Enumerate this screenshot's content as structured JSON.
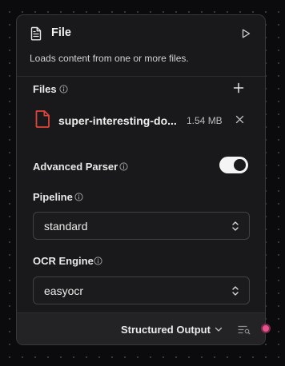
{
  "node": {
    "title": "File",
    "icon": "file-text-icon",
    "description": "Loads content from one or more files."
  },
  "files": {
    "label": "Files",
    "items": [
      {
        "name": "super-interesting-do...",
        "size": "1.54 MB",
        "icon": "pdf-file-icon"
      }
    ]
  },
  "advanced_parser": {
    "label": "Advanced Parser",
    "enabled": true
  },
  "pipeline": {
    "label": "Pipeline",
    "value": "standard"
  },
  "ocr_engine": {
    "label": "OCR Engine",
    "value": "easyocr"
  },
  "output": {
    "label": "Structured Output"
  },
  "colors": {
    "accent_handle": "#e8528e",
    "pdf_icon": "#e0453b"
  }
}
